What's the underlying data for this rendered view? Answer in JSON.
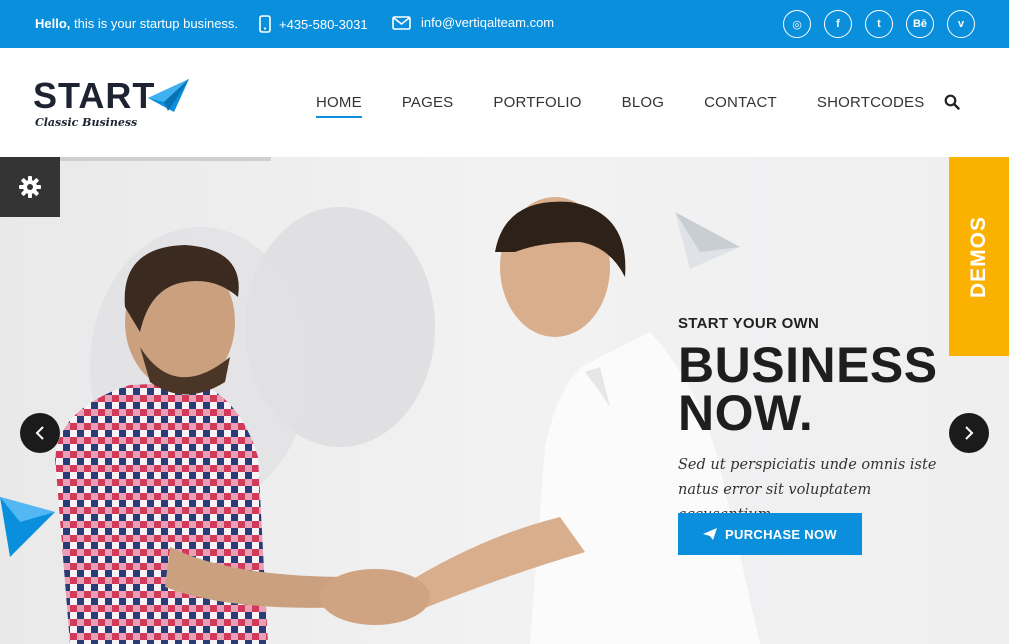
{
  "topbar": {
    "greeting_bold": "Hello,",
    "greeting_rest": " this is your startup business.",
    "phone": "+435-580-3031",
    "email": "info@vertiqalteam.com",
    "social": [
      {
        "icon": "dribbble-icon",
        "glyph": "◎"
      },
      {
        "icon": "facebook-icon",
        "glyph": "f"
      },
      {
        "icon": "twitter-icon",
        "glyph": "t"
      },
      {
        "icon": "behance-icon",
        "glyph": "Bē"
      },
      {
        "icon": "vimeo-icon",
        "glyph": "v"
      }
    ]
  },
  "header": {
    "logo_word": "START",
    "logo_tagline": "Classic Business",
    "nav": [
      "HOME",
      "PAGES",
      "PORTFOLIO",
      "BLOG",
      "CONTACT",
      "SHORTCODES"
    ],
    "active_nav": "HOME"
  },
  "hero": {
    "kicker": "START YOUR OWN",
    "title_line1": "BUSINESS",
    "title_line2": "NOW.",
    "description": "Sed ut perspiciatis unde omnis iste natus error sit voluptatem accusantium.",
    "cta_label": "PURCHASE NOW",
    "demos_label": "DEMOS"
  },
  "colors": {
    "brand_blue": "#0a8fdc",
    "demos_yellow": "#fbb100",
    "dark": "#1d2330"
  }
}
